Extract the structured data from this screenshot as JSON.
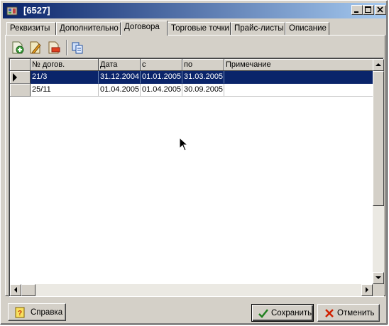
{
  "window": {
    "title": "[6527]"
  },
  "tabs": [
    {
      "label": "Реквизиты"
    },
    {
      "label": "Дополнительно"
    },
    {
      "label": "Договора",
      "active": true
    },
    {
      "label": "Торговые точки"
    },
    {
      "label": "Прайс-листы"
    },
    {
      "label": "Описание"
    }
  ],
  "toolbar": {
    "icons": [
      "add-icon",
      "edit-icon",
      "delete-icon",
      "copy-icon"
    ]
  },
  "grid": {
    "columns": [
      "№ догов.",
      "Дата",
      "с",
      "по",
      "Примечание"
    ],
    "rows": [
      {
        "cells": [
          "21/3",
          "31.12.2004",
          "01.01.2005",
          "31.03.2005",
          ""
        ],
        "selected": true
      },
      {
        "cells": [
          "25/11",
          "01.04.2005",
          "01.04.2005",
          "30.09.2005",
          ""
        ],
        "selected": false
      }
    ]
  },
  "buttons": {
    "help": "Справка",
    "save": "Сохранить",
    "cancel": "Отменить"
  },
  "colors": {
    "title_start": "#0a246a",
    "title_end": "#a6caf0",
    "selection": "#0a246a",
    "face": "#d4d0c8"
  }
}
